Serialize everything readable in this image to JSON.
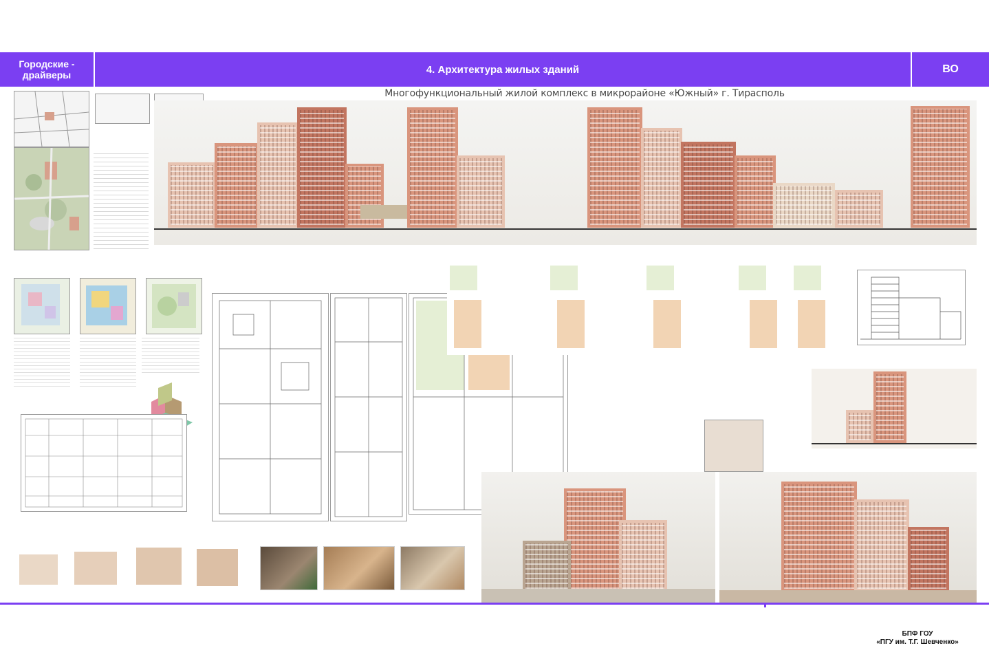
{
  "header": {
    "left_title": "Городские - драйверы",
    "section_title": "4. Архитектура жилых зданий",
    "right_code": "ВО"
  },
  "board": {
    "title": "Многофункциональный жилой комплекс в микрорайоне «Южный» г. Тирасполь"
  },
  "footer": {
    "line1": "БПФ ГОУ",
    "line2": "«ПГУ им. Т.Г. Шевченко»"
  },
  "colors": {
    "accent": "#7b3ff2",
    "facade_brick": "#d9957d",
    "facade_light": "#e7c3b1"
  }
}
